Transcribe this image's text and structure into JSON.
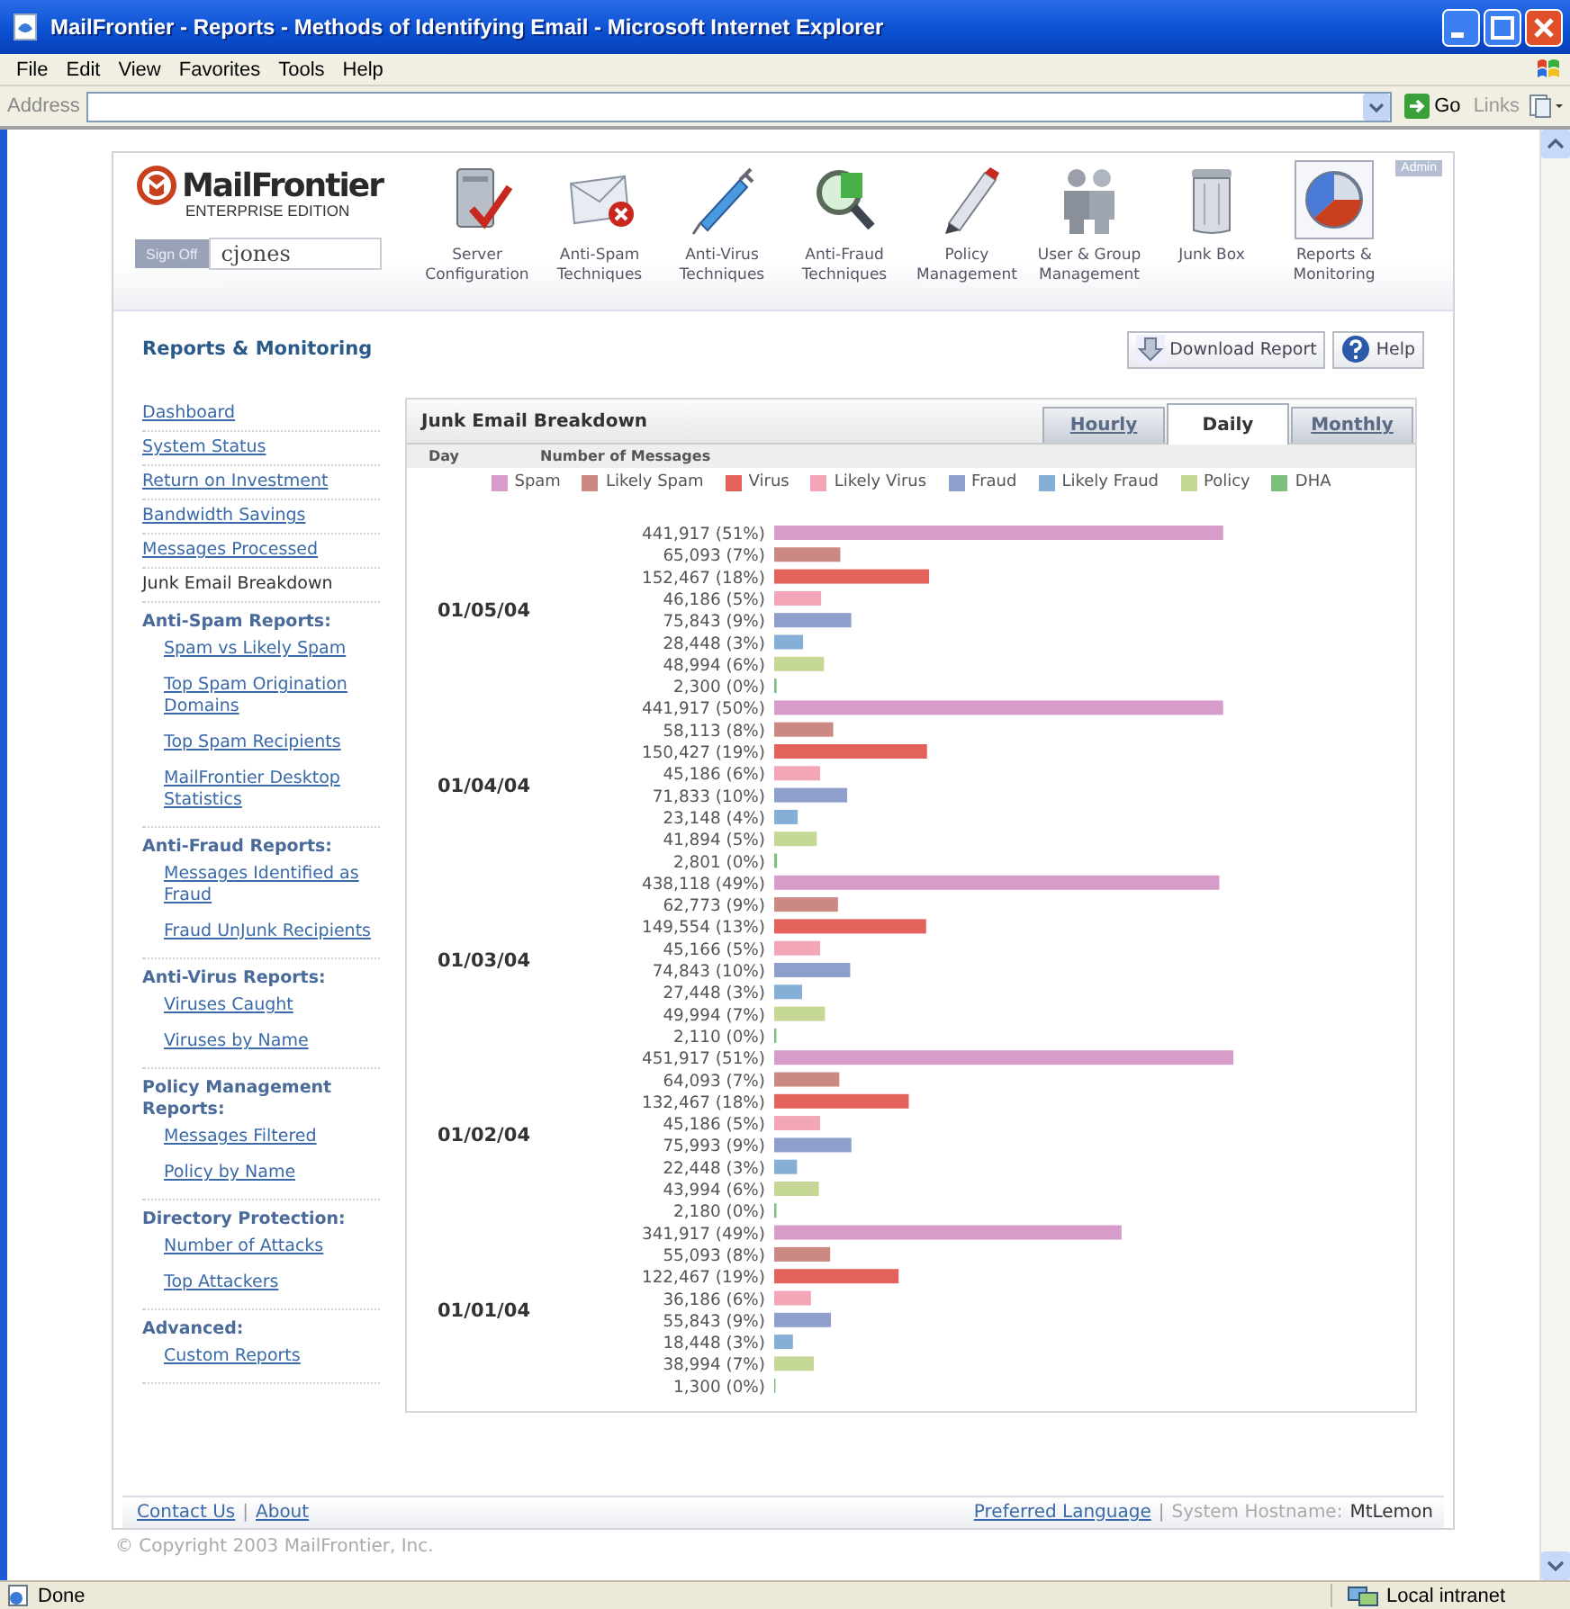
{
  "window": {
    "title": "MailFrontier - Reports - Methods of Identifying Email - Microsoft Internet Explorer"
  },
  "menu": [
    "File",
    "Edit",
    "View",
    "Favorites",
    "Tools",
    "Help"
  ],
  "address_bar": {
    "label": "Address",
    "go": "Go",
    "links": "Links"
  },
  "header": {
    "logo": {
      "name": "MailFrontier",
      "edition": "ENTERPRISE EDITION"
    },
    "sign_off": "Sign Off",
    "user": "cjones",
    "admin": "Admin",
    "nav": [
      {
        "label": "Server Configuration",
        "selected": false
      },
      {
        "label": "Anti-Spam Techniques",
        "selected": false
      },
      {
        "label": "Anti-Virus Techniques",
        "selected": false
      },
      {
        "label": "Anti-Fraud Techniques",
        "selected": false
      },
      {
        "label": "Policy Management",
        "selected": false
      },
      {
        "label": "User & Group Management",
        "selected": false
      },
      {
        "label": "Junk Box",
        "selected": false
      },
      {
        "label": "Reports & Monitoring",
        "selected": true
      }
    ]
  },
  "section": {
    "title": "Reports & Monitoring",
    "buttons": [
      "Download Report",
      "Help"
    ]
  },
  "sidebar": {
    "items": [
      {
        "kind": "link",
        "label": "Dashboard"
      },
      {
        "kind": "link",
        "label": "System Status"
      },
      {
        "kind": "link",
        "label": "Return on Investment"
      },
      {
        "kind": "link",
        "label": "Bandwidth Savings"
      },
      {
        "kind": "link",
        "label": "Messages Processed"
      },
      {
        "kind": "current",
        "label": "Junk Email Breakdown"
      },
      {
        "kind": "heading",
        "label": "Anti-Spam Reports:",
        "children": [
          {
            "kind": "link",
            "label": "Spam vs Likely Spam"
          },
          {
            "kind": "link",
            "label": "Top Spam Origination Domains"
          },
          {
            "kind": "link",
            "label": "Top Spam Recipients"
          },
          {
            "kind": "link",
            "label": "MailFrontier Desktop Statistics"
          }
        ]
      },
      {
        "kind": "heading",
        "label": "Anti-Fraud Reports:",
        "children": [
          {
            "kind": "link",
            "label": "Messages Identified as Fraud"
          },
          {
            "kind": "link",
            "label": "Fraud UnJunk Recipients"
          }
        ]
      },
      {
        "kind": "heading",
        "label": "Anti-Virus Reports:",
        "children": [
          {
            "kind": "link",
            "label": "Viruses Caught"
          },
          {
            "kind": "link",
            "label": "Viruses by Name"
          }
        ]
      },
      {
        "kind": "heading",
        "label": "Policy Management Reports:",
        "children": [
          {
            "kind": "link",
            "label": "Messages Filtered"
          },
          {
            "kind": "link",
            "label": "Policy by Name"
          }
        ]
      },
      {
        "kind": "heading",
        "label": "Directory Protection:",
        "children": [
          {
            "kind": "link",
            "label": "Number of Attacks"
          },
          {
            "kind": "link",
            "label": "Top Attackers"
          }
        ]
      },
      {
        "kind": "heading",
        "label": "Advanced:",
        "children": [
          {
            "kind": "link",
            "label": "Custom Reports"
          }
        ]
      }
    ]
  },
  "report": {
    "title": "Junk Email Breakdown",
    "tabs": [
      {
        "label": "Hourly",
        "selected": false
      },
      {
        "label": "Daily",
        "selected": true
      },
      {
        "label": "Monthly",
        "selected": false
      }
    ],
    "columns": [
      "Day",
      "Number of Messages"
    ],
    "chart_data": {
      "type": "bar",
      "orientation": "horizontal",
      "data_labels": true,
      "categories": [
        "01/05/04",
        "01/04/04",
        "01/03/04",
        "01/02/04",
        "01/01/04"
      ],
      "series": [
        {
          "name": "Spam",
          "color": "#d89ccb",
          "values": [
            441917,
            441917,
            438118,
            451917,
            341917
          ],
          "value_labels": [
            "441,917 (51%)",
            "441,917 (50%)",
            "438,118 (49%)",
            "451,917 (51%)",
            "341,917 (49%)"
          ]
        },
        {
          "name": "Likely Spam",
          "color": "#cc8882",
          "values": [
            65093,
            58113,
            62773,
            64093,
            55093
          ],
          "value_labels": [
            "65,093 (7%)",
            "58,113 (8%)",
            "62,773 (9%)",
            "64,093 (7%)",
            "55,093 (8%)"
          ]
        },
        {
          "name": "Virus",
          "color": "#e4625c",
          "values": [
            152467,
            150427,
            149554,
            132467,
            122467
          ],
          "value_labels": [
            "152,467 (18%)",
            "150,427 (19%)",
            "149,554 (13%)",
            "132,467 (18%)",
            "122,467 (19%)"
          ]
        },
        {
          "name": "Likely Virus",
          "color": "#f2a6b8",
          "values": [
            46186,
            45186,
            45166,
            45186,
            36186
          ],
          "value_labels": [
            "46,186 (5%)",
            "45,186 (6%)",
            "45,166 (5%)",
            "45,186 (5%)",
            "36,186 (6%)"
          ]
        },
        {
          "name": "Fraud",
          "color": "#8e9fcc",
          "values": [
            75843,
            71833,
            74843,
            75993,
            55843
          ],
          "value_labels": [
            "75,843 (9%)",
            "71,833 (10%)",
            "74,843 (10%)",
            "75,993 (9%)",
            "55,843 (9%)"
          ]
        },
        {
          "name": "Likely Fraud",
          "color": "#86afd8",
          "values": [
            28448,
            23148,
            27448,
            22448,
            18448
          ],
          "value_labels": [
            "28,448 (3%)",
            "23,148 (4%)",
            "27,448 (3%)",
            "22,448 (3%)",
            "18,448 (3%)"
          ]
        },
        {
          "name": "Policy",
          "color": "#c6d896",
          "values": [
            48994,
            41894,
            49994,
            43994,
            38994
          ],
          "value_labels": [
            "48,994 (6%)",
            "41,894 (5%)",
            "49,994 (7%)",
            "43,994 (6%)",
            "38,994 (7%)"
          ]
        },
        {
          "name": "DHA",
          "color": "#7dbf7d",
          "values": [
            2300,
            2801,
            2110,
            2180,
            1300
          ],
          "value_labels": [
            "2,300 (0%)",
            "2,801 (0%)",
            "2,110 (0%)",
            "2,180 (0%)",
            "1,300 (0%)"
          ]
        }
      ]
    }
  },
  "footer": {
    "left": [
      {
        "kind": "link",
        "text": "Contact Us"
      },
      {
        "kind": "sep",
        "text": "|"
      },
      {
        "kind": "link",
        "text": "About"
      }
    ],
    "right": [
      {
        "kind": "link",
        "text": "Preferred Language"
      },
      {
        "kind": "sep",
        "text": "|"
      },
      {
        "kind": "label",
        "text": "System Hostname:"
      },
      {
        "kind": "value",
        "text": "MtLemon"
      }
    ],
    "copyright": "© Copyright 2003 MailFrontier, Inc."
  },
  "status_bar": {
    "text": "Done",
    "zone": "Local intranet"
  }
}
